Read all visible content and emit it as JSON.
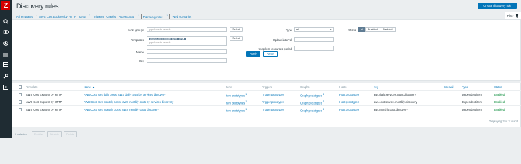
{
  "app": {
    "logo": "Z"
  },
  "header": {
    "title": "Discovery rules",
    "create_label": "Create discovery rule"
  },
  "nav": {
    "all_templates": "All templates",
    "sep": "/",
    "template": "AWS Cost Explorer by HTTP",
    "items": "Items",
    "items_count": "3",
    "triggers": "Triggers",
    "graphs": "Graphs",
    "dashboards": "Dashboards",
    "dashboards_count": "1",
    "discovery": "Discovery rules",
    "discovery_count": "3",
    "web": "Web scenarios"
  },
  "filter": {
    "tab_label": "Filter",
    "host_groups_label": "Host groups",
    "host_groups_placeholder": "type here to search",
    "select_label": "Select",
    "templates_label": "Templates",
    "template_tag": "AWS Cost Explorer by HTTP",
    "templates_placeholder": "type here to search",
    "name_label": "Name",
    "key_label": "Key",
    "type_label": "Type",
    "type_value": "all",
    "update_label": "Update interval",
    "keep_label": "Keep lost resources period",
    "status_label": "Status",
    "status_options": [
      "all",
      "Enabled",
      "Disabled"
    ],
    "apply_label": "Apply",
    "reset_label": "Reset"
  },
  "table": {
    "headers": {
      "template": "Template",
      "name": "Name ▲",
      "items": "Items",
      "triggers": "Triggers",
      "graphs": "Graphs",
      "hosts": "Hosts",
      "key": "Key",
      "interval": "Interval",
      "type": "Type",
      "status": "Status"
    },
    "rows": [
      {
        "template": "AWS Cost Explorer by HTTP",
        "name": "AWS Cost: Get daily costs: AWS daily costs by services discovery",
        "items": "Item prototypes",
        "items_count": "1",
        "triggers": "Trigger prototypes",
        "graphs": "Graph prototypes",
        "graphs_count": "1",
        "hosts": "Host prototypes",
        "key": "aws.daily.services.costs.discovery",
        "interval": "",
        "type": "Dependent item",
        "status": "Enabled"
      },
      {
        "template": "AWS Cost Explorer by HTTP",
        "name": "AWS Cost: Get monthly costs: AWS monthly costs by services discovery",
        "items": "Item prototypes",
        "items_count": "1",
        "triggers": "Trigger prototypes",
        "graphs": "Graph prototypes",
        "graphs_count": "1",
        "hosts": "Host prototypes",
        "key": "aws.cost.service.monthly.discovery",
        "interval": "",
        "type": "Dependent item",
        "status": "Enabled"
      },
      {
        "template": "AWS Cost Explorer by HTTP",
        "name": "AWS Cost: Get monthly costs: AWS monthly costs discovery",
        "items": "Item prototypes",
        "items_count": "1",
        "triggers": "Trigger prototypes",
        "graphs": "Graph prototypes",
        "graphs_count": "1",
        "hosts": "Host prototypes",
        "key": "aws.monthly.cost.discovery",
        "interval": "",
        "type": "Dependent item",
        "status": "Enabled"
      }
    ],
    "displaying": "Displaying 3 of 3 found"
  },
  "footer": {
    "selected": "0 selected",
    "enable": "Enable",
    "disable": "Disable",
    "delete": "Delete"
  }
}
